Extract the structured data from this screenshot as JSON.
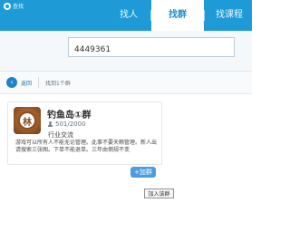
{
  "app": {
    "brand_text": "查找",
    "brand_icon": "qq-logo-icon"
  },
  "tabs": [
    {
      "label": "找人",
      "active": false
    },
    {
      "label": "找群",
      "active": true
    },
    {
      "label": "找课程",
      "active": false
    }
  ],
  "search": {
    "value": "4449361",
    "placeholder": ""
  },
  "navigation": {
    "back_label": "返回",
    "back_icon": "back-arrow-icon",
    "result_text": "找到1个群"
  },
  "result_card": {
    "avatar_text": "林",
    "group_name": "钓鱼岛①群",
    "member_count": "501/2000",
    "member_icon": "member-icon",
    "category": "行业交流",
    "description": "游戏可以所有人不能无论管理。此事不要天赖管理。新人出请搜索三张图。下单不能退单。三年由佣规不变",
    "join_button_label": "+加群",
    "tooltip": "加入该群"
  },
  "colors": {
    "topbar": "#1e9bd7",
    "active_tab_text": "#1e8ec9",
    "button": "#4c9ddf"
  }
}
